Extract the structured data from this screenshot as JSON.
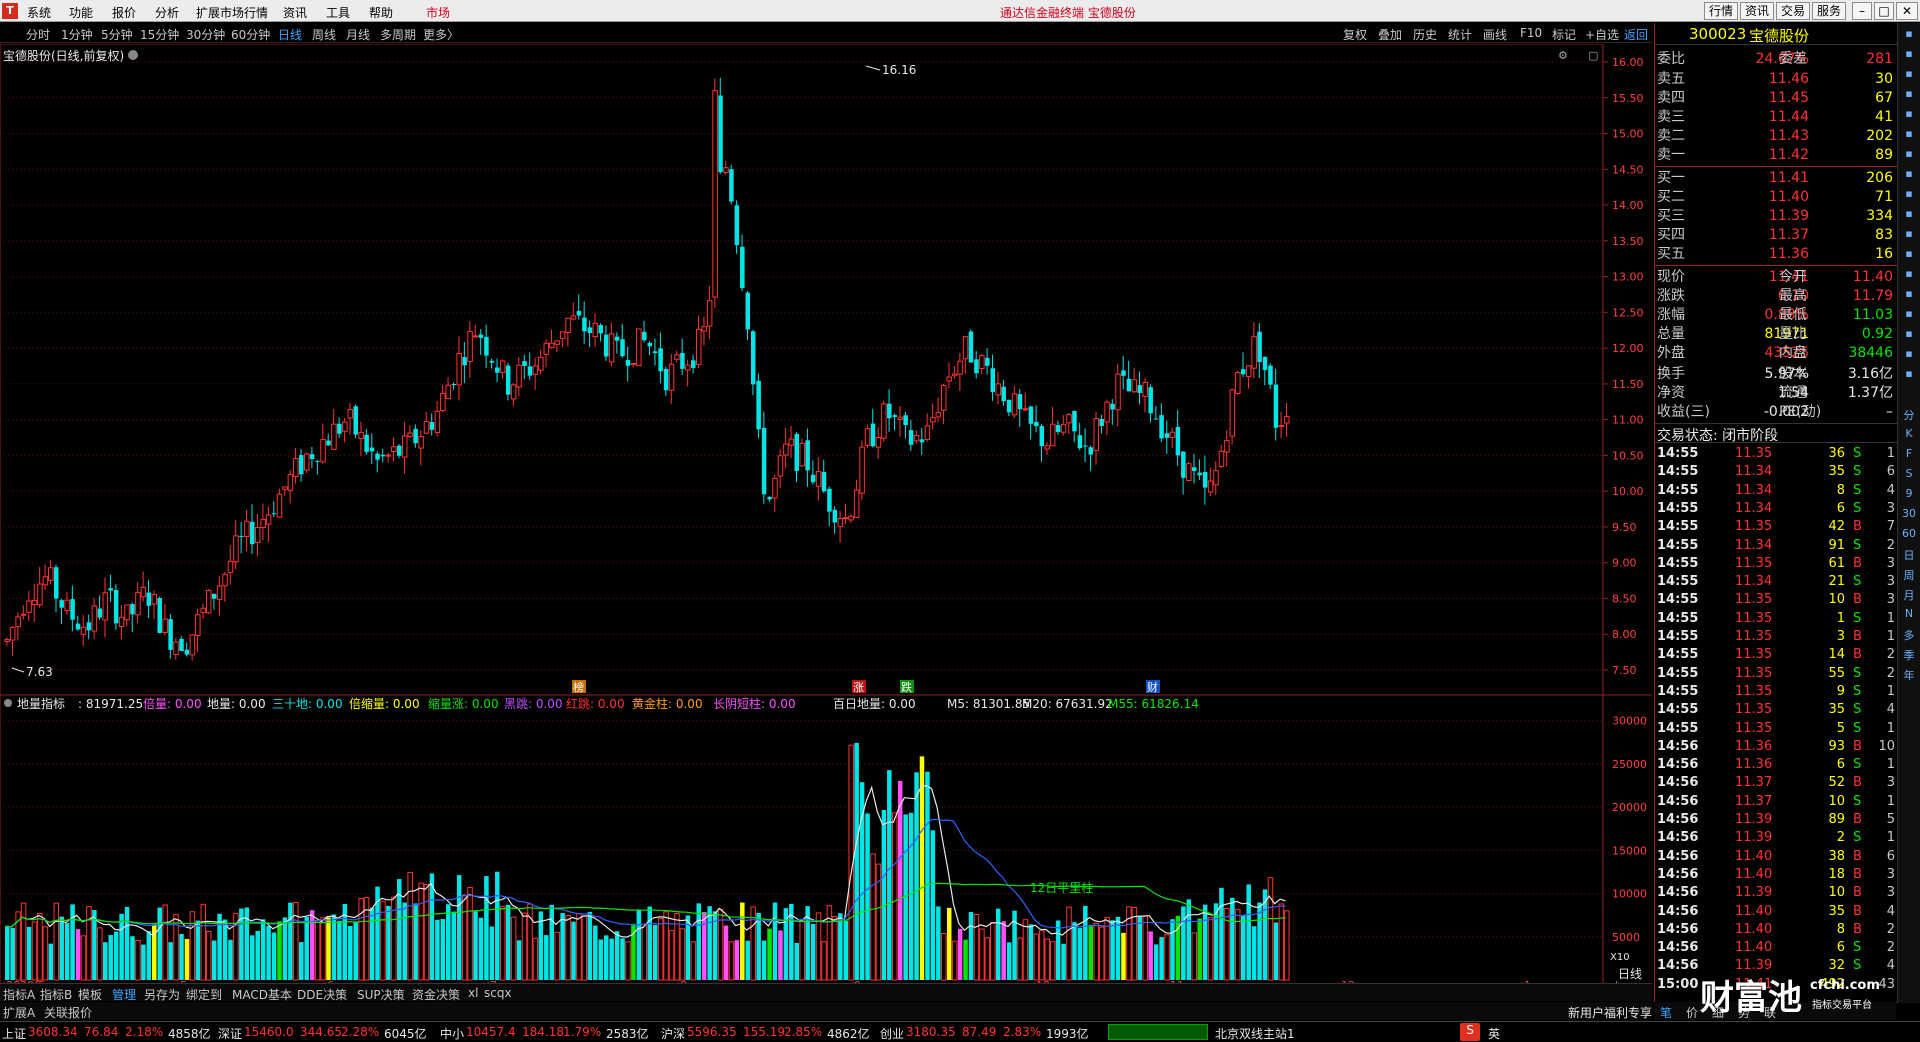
{
  "menubar": {
    "items": [
      "系统",
      "功能",
      "报价",
      "分析",
      "扩展市场行情",
      "资讯",
      "工具",
      "帮助",
      "市场"
    ],
    "center_title": "通达信金融终端  宝德股份",
    "right_buttons": [
      "行情",
      "资讯",
      "交易",
      "服务"
    ]
  },
  "periodbar": {
    "periods": [
      "分时",
      "1分钟",
      "5分钟",
      "15分钟",
      "30分钟",
      "60分钟",
      "日线",
      "周线",
      "月线",
      "多周期",
      "更多〉"
    ],
    "selected": "日线",
    "tools": [
      "复权",
      "叠加",
      "历史",
      "统计",
      "画线",
      "F10",
      "标记",
      "+自选",
      "返回"
    ]
  },
  "chart": {
    "title": "宝德股份(日线,前复权)",
    "price_ticks": [
      "16.00",
      "15.50",
      "15.00",
      "14.50",
      "14.00",
      "13.50",
      "13.00",
      "12.50",
      "12.00",
      "11.50",
      "11.00",
      "10.50",
      "10.00",
      "9.50",
      "9.00",
      "8.50",
      "8.00",
      "7.50"
    ],
    "high_label": "16.16",
    "low_label": "7.63",
    "markers": [
      "榜",
      "涨",
      "跌",
      "财"
    ],
    "indicator_title": "地量指标",
    "indicator_values": [
      {
        "text": ": 81971.25",
        "color": "#e8e8e8"
      },
      {
        "text": "倍量: 0.00",
        "color": "#ff4fff"
      },
      {
        "text": "地量: 0.00",
        "color": "#e8e8e8"
      },
      {
        "text": "三十地: 0.00",
        "color": "#00e5e5"
      },
      {
        "text": "倍缩量: 0.00",
        "color": "#ffff00"
      },
      {
        "text": "缩量涨: 0.00",
        "color": "#00e600"
      },
      {
        "text": "黑跳: 0.00",
        "color": "#c050ff"
      },
      {
        "text": "红跳: 0.00",
        "color": "#ff3232"
      },
      {
        "text": "黄金柱: 0.00",
        "color": "#ff9a20"
      },
      {
        "text": "长阴短柱: 0.00",
        "color": "#ff4fff"
      },
      {
        "text": "百日地量: 0.00",
        "color": "#e8e8e8"
      },
      {
        "text": "M5: 81301.85",
        "color": "#e8e8e8"
      },
      {
        "text": "M20: 67631.92",
        "color": "#e8e8e8"
      },
      {
        "text": "M55: 61826.14",
        "color": "#00e600"
      }
    ],
    "volume_ticks": [
      "30000",
      "25000",
      "20000",
      "15000",
      "10000",
      "5000"
    ],
    "volume_unit": "X10",
    "annotation": "12日平里柱",
    "x_labels": [
      "2020年",
      "5",
      "6",
      "7",
      "8",
      "9",
      "10",
      "11",
      "12",
      "1"
    ],
    "period_label": "日线"
  },
  "quote": {
    "code": "300023",
    "name": "宝德股份",
    "weibi_label": "委比",
    "weibi": "24.67%",
    "weicha_label": "委差",
    "weicha": "281",
    "asks": [
      {
        "label": "卖五",
        "price": "11.46",
        "vol": "30"
      },
      {
        "label": "卖四",
        "price": "11.45",
        "vol": "67"
      },
      {
        "label": "卖三",
        "price": "11.44",
        "vol": "41"
      },
      {
        "label": "卖二",
        "price": "11.43",
        "vol": "202"
      },
      {
        "label": "卖一",
        "price": "11.42",
        "vol": "89"
      }
    ],
    "bids": [
      {
        "label": "买一",
        "price": "11.41",
        "vol": "206"
      },
      {
        "label": "买二",
        "price": "11.40",
        "vol": "71"
      },
      {
        "label": "买三",
        "price": "11.39",
        "vol": "334"
      },
      {
        "label": "买四",
        "price": "11.37",
        "vol": "83"
      },
      {
        "label": "买五",
        "price": "11.36",
        "vol": "16"
      }
    ],
    "stats": [
      {
        "l": "现价",
        "v": "11.41",
        "vc": "red",
        "l2": "今开",
        "v2": "11.40",
        "v2c": "red"
      },
      {
        "l": "涨跌",
        "v": "0.10",
        "vc": "red",
        "l2": "最高",
        "v2": "11.79",
        "v2c": "red"
      },
      {
        "l": "涨幅",
        "v": "0.88%",
        "vc": "red",
        "l2": "最低",
        "v2": "11.03",
        "v2c": "green"
      },
      {
        "l": "总量",
        "v": "81971",
        "vc": "yellow",
        "l2": "量比",
        "v2": "0.92",
        "v2c": "green"
      },
      {
        "l": "外盘",
        "v": "43525",
        "vc": "red",
        "l2": "内盘",
        "v2": "38446",
        "v2c": "green"
      },
      {
        "l": "换手",
        "v": "5.97%",
        "vc": "white",
        "l2": "股本",
        "v2": "3.16亿",
        "v2c": "white"
      },
      {
        "l": "净资",
        "v": "1.54",
        "vc": "white",
        "l2": "流通",
        "v2": "1.37亿",
        "v2c": "white"
      },
      {
        "l": "收益(三)",
        "v": "-0.002",
        "vc": "white",
        "l2": "PE(动)",
        "v2": "–",
        "v2c": "white"
      }
    ],
    "trade_status": "交易状态: 闭市阶段",
    "ticks": [
      {
        "t": "14:55",
        "p": "11.35",
        "v": "36",
        "b": "S",
        "c": "1"
      },
      {
        "t": "14:55",
        "p": "11.34",
        "v": "35",
        "b": "S",
        "c": "6"
      },
      {
        "t": "14:55",
        "p": "11.34",
        "v": "8",
        "b": "S",
        "c": "4"
      },
      {
        "t": "14:55",
        "p": "11.34",
        "v": "6",
        "b": "S",
        "c": "3"
      },
      {
        "t": "14:55",
        "p": "11.35",
        "v": "42",
        "b": "B",
        "c": "7"
      },
      {
        "t": "14:55",
        "p": "11.34",
        "v": "91",
        "b": "S",
        "c": "2"
      },
      {
        "t": "14:55",
        "p": "11.35",
        "v": "61",
        "b": "B",
        "c": "3"
      },
      {
        "t": "14:55",
        "p": "11.34",
        "v": "21",
        "b": "S",
        "c": "3"
      },
      {
        "t": "14:55",
        "p": "11.35",
        "v": "10",
        "b": "B",
        "c": "3"
      },
      {
        "t": "14:55",
        "p": "11.35",
        "v": "1",
        "b": "S",
        "c": "1"
      },
      {
        "t": "14:55",
        "p": "11.35",
        "v": "3",
        "b": "B",
        "c": "1"
      },
      {
        "t": "14:55",
        "p": "11.35",
        "v": "14",
        "b": "B",
        "c": "2"
      },
      {
        "t": "14:55",
        "p": "11.35",
        "v": "55",
        "b": "S",
        "c": "2"
      },
      {
        "t": "14:55",
        "p": "11.35",
        "v": "9",
        "b": "S",
        "c": "1"
      },
      {
        "t": "14:55",
        "p": "11.35",
        "v": "35",
        "b": "S",
        "c": "4"
      },
      {
        "t": "14:55",
        "p": "11.35",
        "v": "5",
        "b": "S",
        "c": "1"
      },
      {
        "t": "14:56",
        "p": "11.36",
        "v": "93",
        "b": "B",
        "c": "10"
      },
      {
        "t": "14:56",
        "p": "11.36",
        "v": "6",
        "b": "S",
        "c": "1"
      },
      {
        "t": "14:56",
        "p": "11.37",
        "v": "52",
        "b": "B",
        "c": "3"
      },
      {
        "t": "14:56",
        "p": "11.37",
        "v": "10",
        "b": "S",
        "c": "1"
      },
      {
        "t": "14:56",
        "p": "11.39",
        "v": "89",
        "b": "B",
        "c": "5"
      },
      {
        "t": "14:56",
        "p": "11.39",
        "v": "2",
        "b": "S",
        "c": "1"
      },
      {
        "t": "14:56",
        "p": "11.40",
        "v": "38",
        "b": "B",
        "c": "6"
      },
      {
        "t": "14:56",
        "p": "11.40",
        "v": "18",
        "b": "B",
        "c": "3"
      },
      {
        "t": "14:56",
        "p": "11.39",
        "v": "10",
        "b": "B",
        "c": "3"
      },
      {
        "t": "14:56",
        "p": "11.40",
        "v": "35",
        "b": "B",
        "c": "4"
      },
      {
        "t": "14:56",
        "p": "11.40",
        "v": "8",
        "b": "B",
        "c": "2"
      },
      {
        "t": "14:56",
        "p": "11.40",
        "v": "6",
        "b": "S",
        "c": "2"
      },
      {
        "t": "14:56",
        "p": "11.39",
        "v": "32",
        "b": "S",
        "c": "4"
      },
      {
        "t": "15:00",
        "p": "11.41",
        "v": "492",
        "b": "",
        "c": "43"
      }
    ],
    "bottom_tabs": [
      "笔",
      "价",
      "细",
      "势",
      "联"
    ]
  },
  "iconstrip": [
    "分",
    "K",
    "F",
    "S",
    "9",
    "30",
    "60",
    "日",
    "周",
    "月",
    "N",
    "多",
    "季",
    "年"
  ],
  "tabs_row1": [
    "指标A",
    "指标B",
    "模板",
    "管理",
    "另存为",
    "绑定到",
    "MACD基本",
    "DDE决策",
    "SUP决策",
    "资金决策",
    "xl",
    "scqx"
  ],
  "tabs_row1_selected": "管理",
  "tabs_row2": [
    "扩展A",
    "关联报价"
  ],
  "tabs_row2_right": "新用户福利专享",
  "status": [
    {
      "name": "上证",
      "v": "3608.34",
      "c": "76.84",
      "p": "2.18%",
      "amt": "4858亿"
    },
    {
      "name": "深证",
      "v": "15460.0",
      "c": "344.65",
      "p": "2.28%",
      "amt": "6045亿"
    },
    {
      "name": "中小",
      "v": "10457.4",
      "c": "184.18",
      "p": "1.79%",
      "amt": "2583亿"
    },
    {
      "name": "沪深",
      "v": "5596.35",
      "c": "155.19",
      "p": "2.85%",
      "amt": "4862亿"
    },
    {
      "name": "创业",
      "v": "3180.35",
      "c": "87.49",
      "p": "2.83%",
      "amt": "1993亿"
    }
  ],
  "status_server": "北京双线主站1",
  "watermark": "财富池",
  "watermark_url": "cfchi.com",
  "watermark_sub": "指标交易平台"
}
